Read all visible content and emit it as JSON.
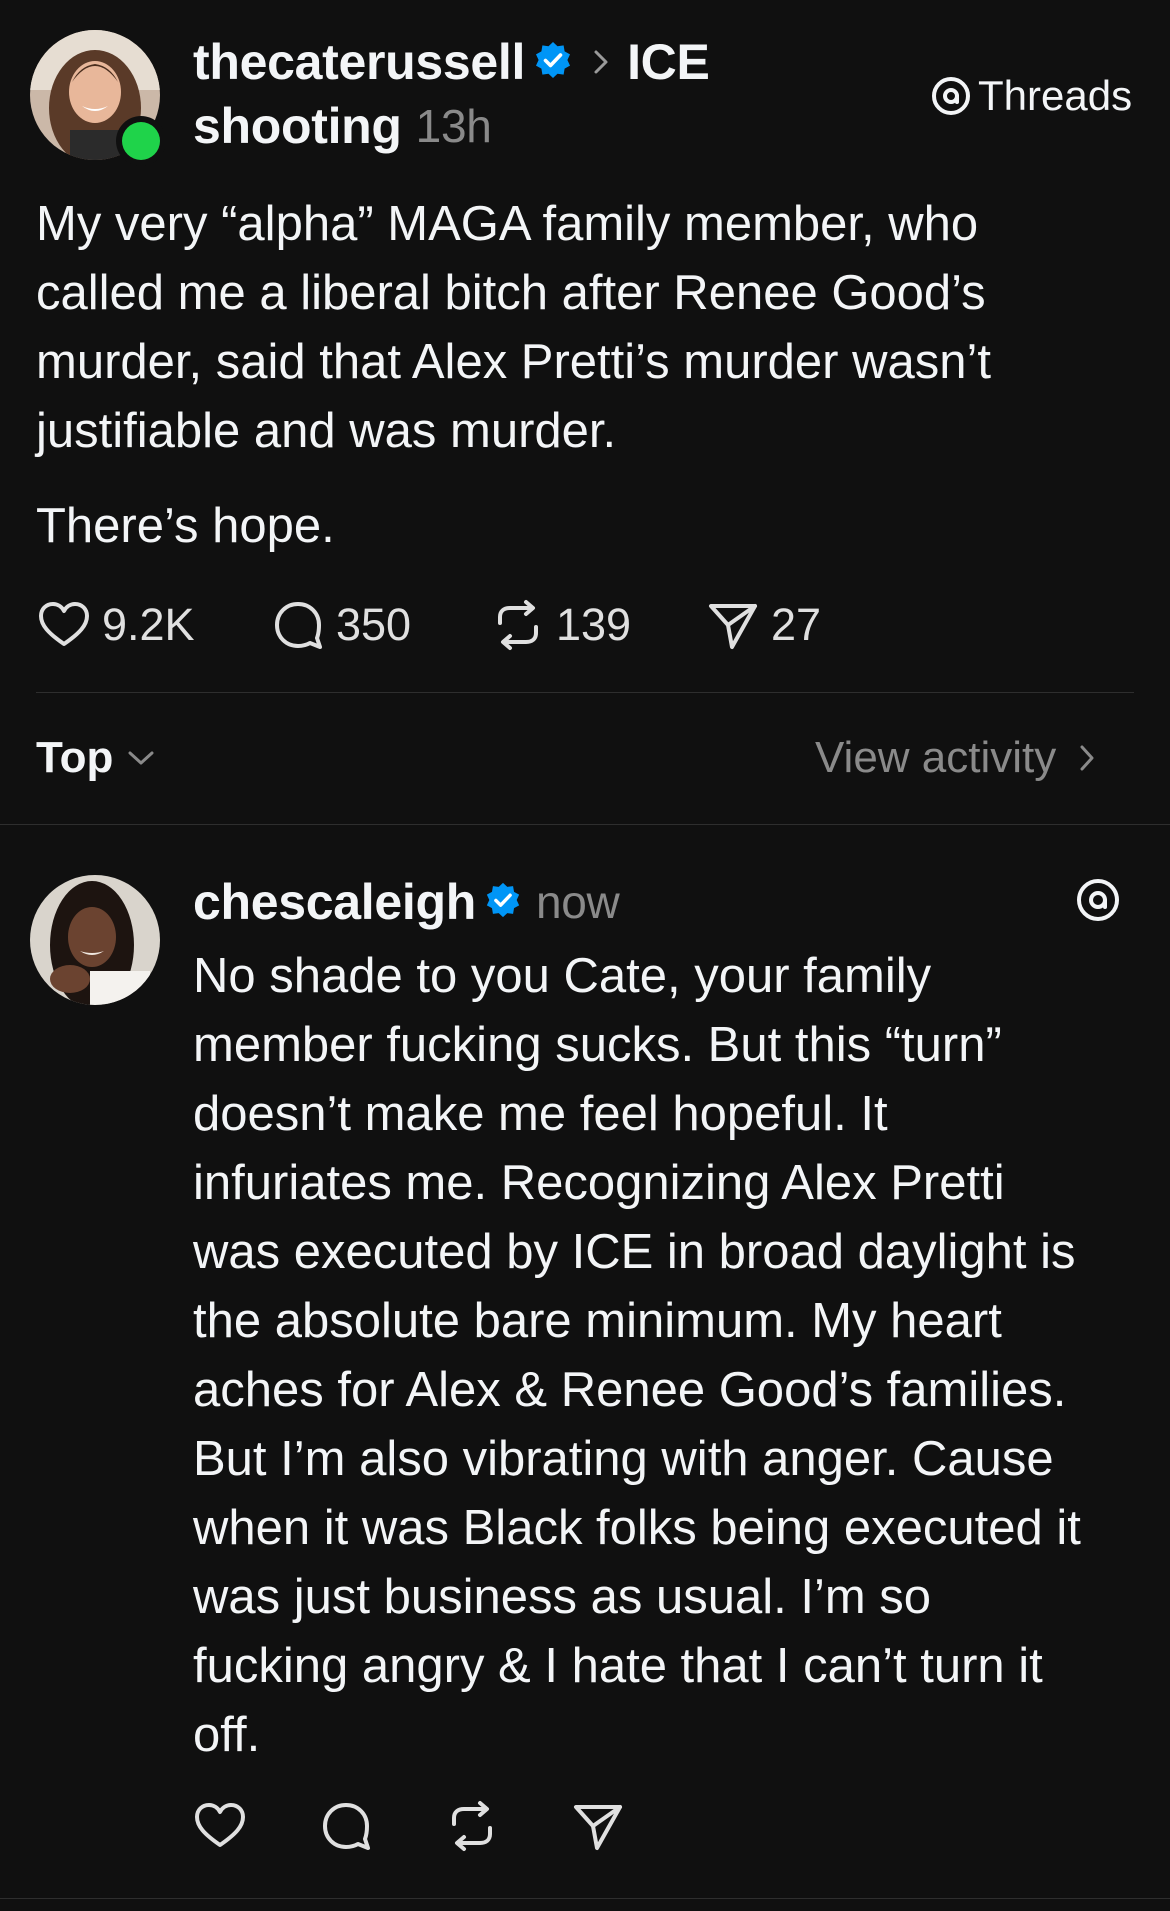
{
  "post": {
    "username": "thecaterussell",
    "topic_line1": "ICE",
    "topic_line2": "shooting",
    "time": "13h",
    "app_label": "Threads",
    "text_p1": [
      "My very “alpha” MAGA family member, who",
      "called me a liberal bitch after Renee Good’s",
      "murder, said that Alex Pretti’s murder wasn’t",
      "justifiable and was murder."
    ],
    "text_p2": "There’s hope.",
    "stats": {
      "likes": "9.2K",
      "replies": "350",
      "reposts": "139",
      "shares": "27"
    }
  },
  "sort_bar": {
    "sort_label": "Top",
    "view_activity": "View activity"
  },
  "reply": {
    "username": "chescaleigh",
    "time": "now",
    "text_lines": [
      "No shade to you Cate, your family",
      "member fucking sucks. But this “turn”",
      "doesn’t make me feel hopeful. It",
      "infuriates me. Recognizing Alex Pretti",
      "was executed by ICE in broad daylight is",
      "the absolute bare minimum. My heart",
      "aches for Alex & Renee Good’s families.",
      "But I’m also vibrating with anger. Cause",
      "when it was Black folks being executed it",
      "was just business as usual. I’m so",
      "fucking angry & I hate that I can’t turn it",
      "off."
    ]
  },
  "colors": {
    "background": "#101010",
    "text": "#f3f5f7",
    "muted": "#8a8a8a",
    "verified": "#0095f6",
    "online": "#1fd34a"
  },
  "icons": {
    "like": "heart-icon",
    "reply": "comment-icon",
    "repost": "repost-icon",
    "share": "send-icon",
    "threads": "threads-logo-icon",
    "verified": "verified-badge-icon"
  }
}
